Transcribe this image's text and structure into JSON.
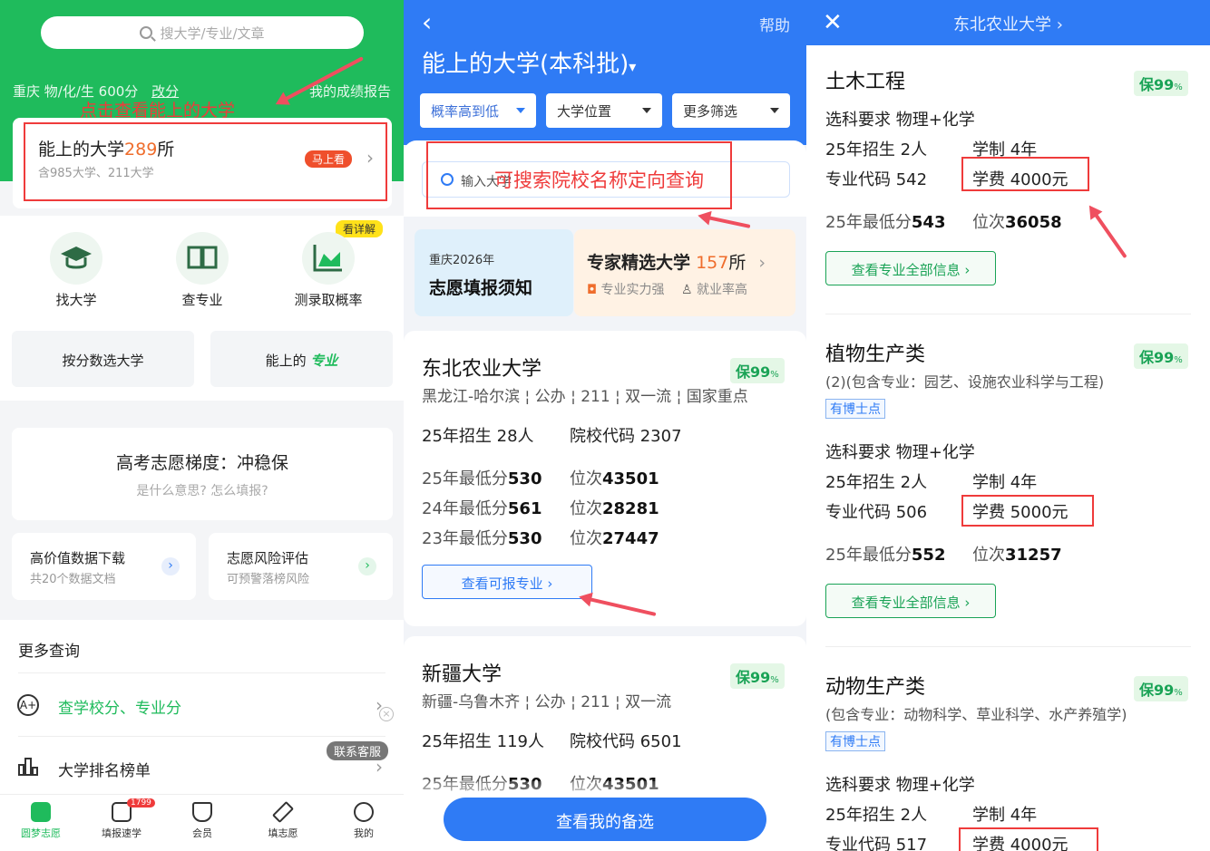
{
  "p1": {
    "search_placeholder": "搜大学/专业/文章",
    "region_info": "重庆  物/化/生 600分",
    "change_score": "改分",
    "my_report": "我的成绩报告",
    "annotation": "点击查看能上的大学",
    "main_card": {
      "title_prefix": "能上的大学",
      "count": "289",
      "suffix": "所",
      "sub": "含985大学、211大学",
      "badge": "马上看"
    },
    "see_detail": "看详解",
    "features": [
      "找大学",
      "查专业",
      "测录取概率"
    ],
    "score_btn": "按分数选大学",
    "major_btn_prefix": "能上的",
    "major_btn_hl": "专业",
    "gradient": {
      "title": "高考志愿梯度：冲稳保",
      "sub": "是什么意思? 怎么填报?"
    },
    "data_download": {
      "title": "高价值数据下载",
      "sub": "共20个数据文档"
    },
    "risk": {
      "title": "志愿风险评估",
      "sub": "可预警落榜风险"
    },
    "more_title": "更多查询",
    "query_school": "查学校分、专业分",
    "ranking": "大学排名榜单",
    "contact": "联系客服",
    "tabs": [
      "圆梦志愿",
      "填报速学",
      "会员",
      "填志愿",
      "我的"
    ],
    "tab_badge": "1799"
  },
  "p2": {
    "help": "帮助",
    "title": "能上的大学(本科批)",
    "filters": [
      "概率高到低",
      "大学位置",
      "更多筛选"
    ],
    "search_placeholder": "输入大学",
    "annotation": "可搜索院校名称定向查询",
    "notice": {
      "top": "重庆2026年",
      "main": "志愿填报须知"
    },
    "expert": {
      "title": "专家精选大学",
      "count": "157",
      "suffix": "所",
      "tag1": "专业实力强",
      "tag2": "就业率高"
    },
    "unis": [
      {
        "name": "东北农业大学",
        "badge": "保99",
        "pct": "%",
        "loc": "黑龙江-哈尔滨 ¦ 公办 ¦ 211 ¦ 双一流 ¦ 国家重点",
        "enroll_label": "25年招生",
        "enroll": "28人",
        "code_label": "院校代码",
        "code": "2307",
        "rows": [
          {
            "y": "25年最低分",
            "s": "530",
            "r": "位次",
            "rv": "43501"
          },
          {
            "y": "24年最低分",
            "s": "561",
            "r": "位次",
            "rv": "28281"
          },
          {
            "y": "23年最低分",
            "s": "530",
            "r": "位次",
            "rv": "27447"
          }
        ],
        "btn": "查看可报专业 ›"
      },
      {
        "name": "新疆大学",
        "badge": "保99",
        "pct": "%",
        "loc": "新疆-乌鲁木齐 ¦ 公办 ¦ 211 ¦ 双一流",
        "enroll_label": "25年招生",
        "enroll": "119人",
        "code_label": "院校代码",
        "code": "6501",
        "rows": [
          {
            "y": "25年最低分",
            "s": "530",
            "r": "位次",
            "rv": "43501"
          }
        ]
      }
    ],
    "bottom_btn": "查看我的备选"
  },
  "p3": {
    "title": "东北农业大学 ›",
    "majors": [
      {
        "name": "土木工程",
        "badge": "保99",
        "pct": "%",
        "req": "选科要求 物理+化学",
        "enroll": "25年招生 2人",
        "years": "学制 4年",
        "code": "专业代码 542",
        "fee": "学费 4000元",
        "min_label": "25年最低分",
        "min": "543",
        "rank_label": "位次",
        "rank": "36058",
        "btn": "查看专业全部信息 ›"
      },
      {
        "name": "植物生产类",
        "badge": "保99",
        "pct": "%",
        "desc": "(2)(包含专业：园艺、设施农业科学与工程)",
        "tag": "有博士点",
        "req": "选科要求 物理+化学",
        "enroll": "25年招生 2人",
        "years": "学制 4年",
        "code": "专业代码 506",
        "fee": "学费 5000元",
        "min_label": "25年最低分",
        "min": "552",
        "rank_label": "位次",
        "rank": "31257",
        "btn": "查看专业全部信息 ›"
      },
      {
        "name": "动物生产类",
        "badge": "保99",
        "pct": "%",
        "desc": "(包含专业：动物科学、草业科学、水产养殖学)",
        "tag": "有博士点",
        "req": "选科要求 物理+化学",
        "enroll": "25年招生 2人",
        "years": "学制 4年",
        "code": "专业代码 517",
        "fee": "学费 4000元"
      }
    ]
  }
}
